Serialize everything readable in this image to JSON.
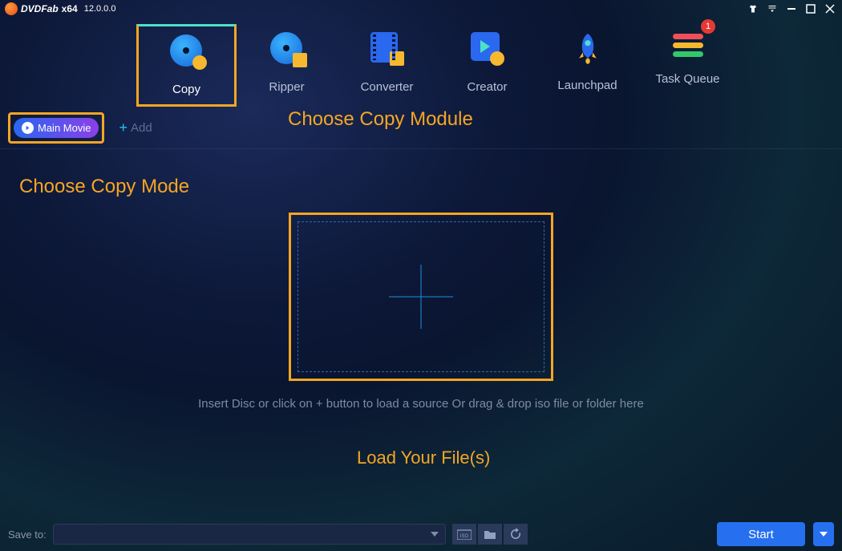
{
  "title": {
    "brand": "DVDFab",
    "arch": "x64",
    "version": "12.0.0.0"
  },
  "modules": [
    {
      "label": "Copy"
    },
    {
      "label": "Ripper"
    },
    {
      "label": "Converter"
    },
    {
      "label": "Creator"
    },
    {
      "label": "Launchpad"
    },
    {
      "label": "Task Queue",
      "badge": "1"
    }
  ],
  "mode": {
    "current": "Main Movie"
  },
  "add": {
    "label": "Add"
  },
  "annotations": {
    "module": "Choose Copy Module",
    "mode": "Choose Copy Mode",
    "load": "Load Your File(s)"
  },
  "hint": "Insert Disc or click on + button to load a source Or drag & drop iso file or folder here",
  "bottom": {
    "save_label": "Save to:",
    "start": "Start"
  }
}
